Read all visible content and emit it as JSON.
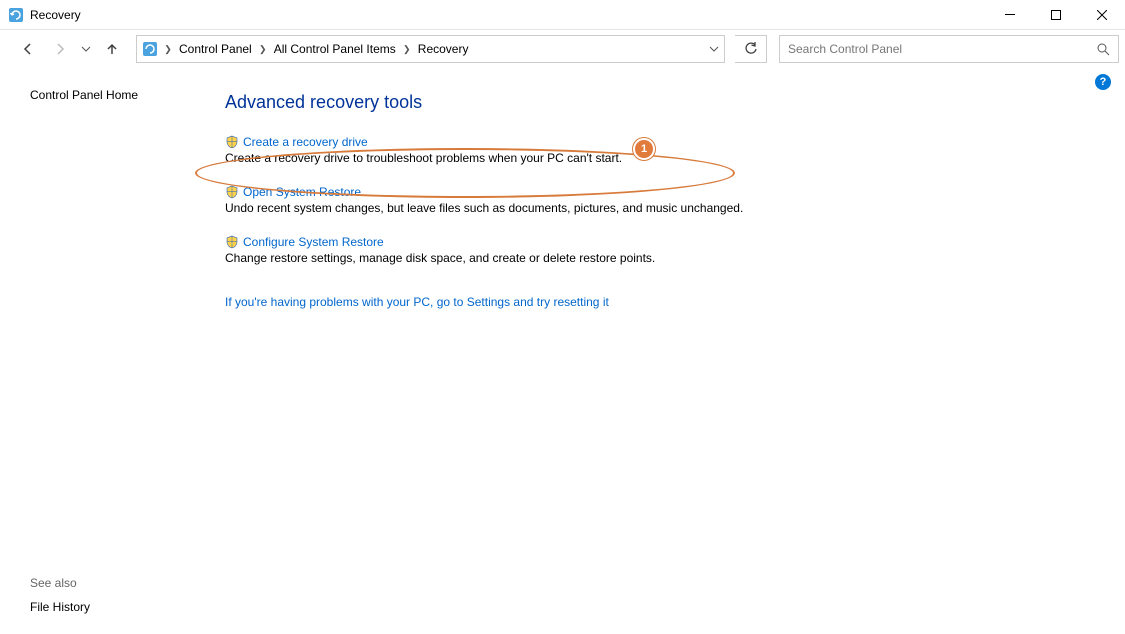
{
  "window": {
    "title": "Recovery"
  },
  "breadcrumb": {
    "items": [
      "Control Panel",
      "All Control Panel Items",
      "Recovery"
    ]
  },
  "search": {
    "placeholder": "Search Control Panel"
  },
  "sidebar": {
    "home": "Control Panel Home",
    "see_also_label": "See also",
    "see_also_links": [
      "File History"
    ]
  },
  "main": {
    "heading": "Advanced recovery tools",
    "tools": [
      {
        "link": "Create a recovery drive",
        "desc": "Create a recovery drive to troubleshoot problems when your PC can't start."
      },
      {
        "link": "Open System Restore",
        "desc": "Undo recent system changes, but leave files such as documents, pictures, and music unchanged."
      },
      {
        "link": "Configure System Restore",
        "desc": "Change restore settings, manage disk space, and create or delete restore points."
      }
    ],
    "trouble_link": "If you're having problems with your PC, go to Settings and try resetting it"
  },
  "annotation": {
    "num": "1"
  },
  "help": {
    "label": "?"
  }
}
